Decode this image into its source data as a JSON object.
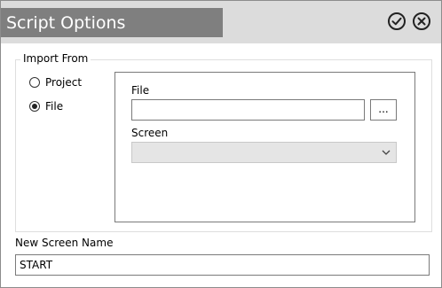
{
  "window": {
    "title": "Script Options",
    "confirm_icon": "check-circle-icon",
    "close_icon": "close-circle-icon"
  },
  "import_from": {
    "legend": "Import From",
    "options": [
      {
        "label": "Project",
        "selected": false
      },
      {
        "label": "File",
        "selected": true
      }
    ],
    "file_label": "File",
    "file_value": "",
    "browse_label": "...",
    "screen_label": "Screen",
    "screen_value": ""
  },
  "new_screen": {
    "label": "New Screen Name",
    "value": "START"
  }
}
